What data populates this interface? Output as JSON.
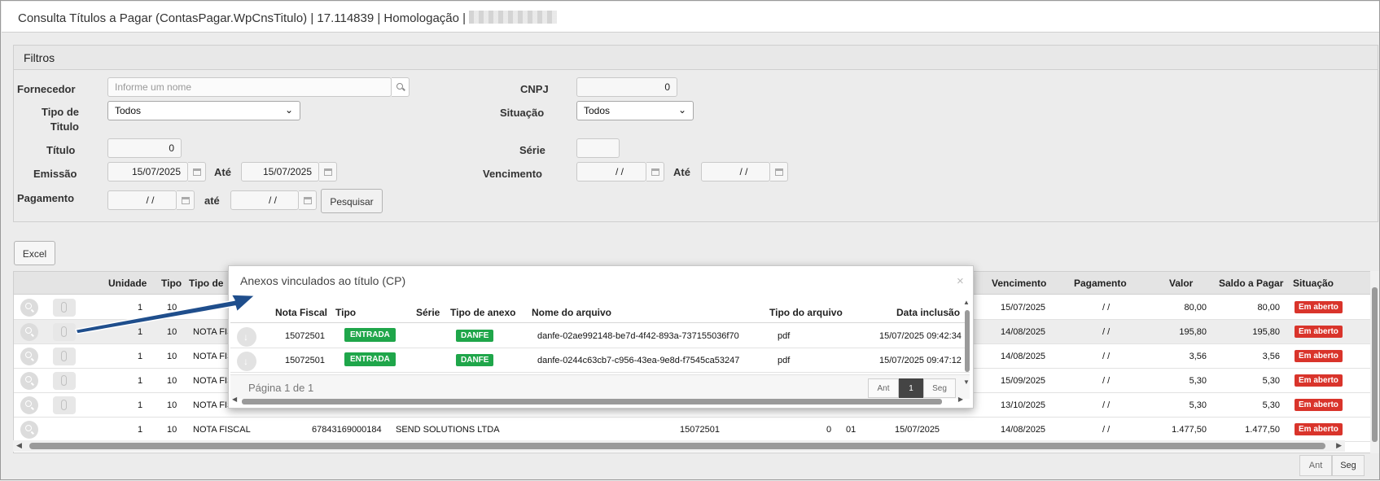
{
  "title_bar": {
    "text": "Consulta Títulos a Pagar (ContasPagar.WpCnsTitulo) | 17.114839 | Homologação |"
  },
  "filters": {
    "panel_title": "Filtros",
    "fornecedor_label": "Fornecedor",
    "fornecedor_placeholder": "Informe um nome",
    "cnpj_label": "CNPJ",
    "cnpj_value": "0",
    "tipo_titulo_label_1": "Tipo de",
    "tipo_titulo_label_2": "Titulo",
    "tipo_titulo_value": "Todos",
    "situacao_label": "Situação",
    "situacao_value": "Todos",
    "titulo_label": "Título",
    "titulo_value": "0",
    "serie_label": "Série",
    "serie_value": "",
    "emissao_label": "Emissão",
    "emissao_de": "15/07/2025",
    "ate_label": "Até",
    "emissao_ate": "15/07/2025",
    "vencimento_label": "Vencimento",
    "vencimento_de": "/ /",
    "vencimento_ate_label": "Até",
    "vencimento_ate": "/ /",
    "pagamento_label": "Pagamento",
    "pagamento_de": "/ /",
    "pagamento_ate_label": "até",
    "pagamento_ate": "/ /",
    "pesquisar_label": "Pesquisar"
  },
  "excel_label": "Excel",
  "grid": {
    "headers": {
      "unidade": "Unidade",
      "tipo": "Tipo",
      "tipo_de": "Tipo de",
      "vencimento": "Vencimento",
      "pagamento": "Pagamento",
      "valor": "Valor",
      "saldo": "Saldo a Pagar",
      "situacao": "Situação"
    },
    "rows": [
      {
        "unidade": "1",
        "tipo": "10",
        "tipo_de": "",
        "vencimento": "15/07/2025",
        "pagamento": "/ /",
        "valor": "80,00",
        "saldo": "80,00",
        "situacao": "Em aberto"
      },
      {
        "unidade": "1",
        "tipo": "10",
        "tipo_de": "NOTA FIS",
        "vencimento": "14/08/2025",
        "pagamento": "/ /",
        "valor": "195,80",
        "saldo": "195,80",
        "situacao": "Em aberto"
      },
      {
        "unidade": "1",
        "tipo": "10",
        "tipo_de": "NOTA FIS",
        "vencimento": "14/08/2025",
        "pagamento": "/ /",
        "valor": "3,56",
        "saldo": "3,56",
        "situacao": "Em aberto"
      },
      {
        "unidade": "1",
        "tipo": "10",
        "tipo_de": "NOTA FIS",
        "vencimento": "15/09/2025",
        "pagamento": "/ /",
        "valor": "5,30",
        "saldo": "5,30",
        "situacao": "Em aberto"
      },
      {
        "unidade": "1",
        "tipo": "10",
        "tipo_de": "NOTA FIS",
        "vencimento": "13/10/2025",
        "pagamento": "/ /",
        "valor": "5,30",
        "saldo": "5,30",
        "situacao": "Em aberto"
      }
    ],
    "last_row": {
      "unidade": "1",
      "tipo": "10",
      "tipo_de": "NOTA FISCAL",
      "cnpj": "67843169000184",
      "fornecedor": "SEND SOLUTIONS LTDA",
      "nota": "15072501",
      "zero": "0",
      "serie": "01",
      "emissao": "15/07/2025",
      "vencimento": "14/08/2025",
      "pagamento": "/ /",
      "valor": "1.477,50",
      "saldo": "1.477,50",
      "situacao": "Em aberto"
    }
  },
  "pager": {
    "prev": "Ant",
    "next": "Seg"
  },
  "modal": {
    "title": "Anexos vinculados ao título (CP)",
    "close": "×",
    "headers": {
      "nota_fiscal": "Nota Fiscal",
      "tipo": "Tipo",
      "serie": "Série",
      "tipo_anexo": "Tipo de anexo",
      "nome_arquivo": "Nome do arquivo",
      "tipo_arquivo": "Tipo do arquivo",
      "data_inclusao": "Data inclusão"
    },
    "rows": [
      {
        "nota_fiscal": "15072501",
        "tipo": "ENTRADA",
        "serie": "",
        "tipo_anexo": "DANFE",
        "nome_arquivo": "danfe-02ae992148-be7d-4f42-893a-737155036f70",
        "tipo_arquivo": "pdf",
        "data_inclusao": "15/07/2025 09:42:34"
      },
      {
        "nota_fiscal": "15072501",
        "tipo": "ENTRADA",
        "serie": "",
        "tipo_anexo": "DANFE",
        "nome_arquivo": "danfe-0244c63cb7-c956-43ea-9e8d-f7545ca53247",
        "tipo_arquivo": "pdf",
        "data_inclusao": "15/07/2025 09:47:12"
      }
    ],
    "page_text": "Página 1 de 1",
    "pager": {
      "prev": "Ant",
      "current": "1",
      "next": "Seg"
    }
  },
  "colors": {
    "badge_red": "#d9342b",
    "badge_green": "#1fa64a",
    "arrow": "#1f4e8c"
  }
}
